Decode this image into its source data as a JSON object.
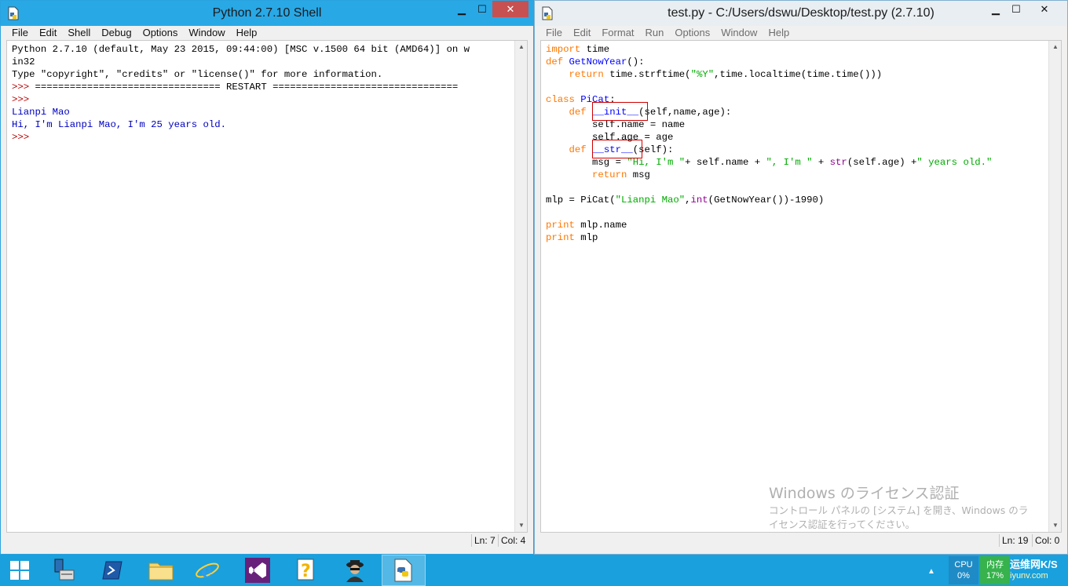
{
  "shell_window": {
    "title": "Python 2.7.10 Shell",
    "menu": [
      "File",
      "Edit",
      "Shell",
      "Debug",
      "Options",
      "Window",
      "Help"
    ],
    "lines": [
      "Python 2.7.10 (default, May 23 2015, 09:44:00) [MSC v.1500 64 bit (AMD64)] on w",
      "in32",
      "Type \"copyright\", \"credits\" or \"license()\" for more information.",
      ">>> ================================ RESTART ================================",
      ">>> ",
      "Lianpi Mao",
      "Hi, I'm Lianpi Mao, I'm 25 years old.",
      ">>> "
    ],
    "status_ln": "Ln: 7",
    "status_col": "Col: 4"
  },
  "editor_window": {
    "title": "test.py - C:/Users/dswu/Desktop/test.py (2.7.10)",
    "menu": [
      "File",
      "Edit",
      "Format",
      "Run",
      "Options",
      "Window",
      "Help"
    ],
    "code_lines": [
      "import time",
      "def GetNowYear():",
      "    return time.strftime(\"%Y\",time.localtime(time.time()))",
      "",
      "class PiCat:",
      "    def __init__(self,name,age):",
      "        self.name = name",
      "        self.age = age",
      "    def __str__(self):",
      "        msg = \"Hi, I'm \"+ self.name + \", I'm \" + str(self.age) +\" years old.\"",
      "        return msg",
      "",
      "mlp = PiCat(\"Lianpi Mao\",int(GetNowYear())-1990)",
      "",
      "print mlp.name",
      "print mlp"
    ],
    "status_ln": "Ln: 19",
    "status_col": "Col: 0",
    "watermark_title": "Windows のライセンス認証",
    "watermark_line1": "コントロール パネルの [システム] を開き、Windows のラ",
    "watermark_line2": "イセンス認証を行ってください。"
  },
  "taskbar": {
    "cpu_label": "CPU",
    "cpu_value": "0%",
    "mem_label": "内存",
    "mem_value": "17%",
    "site_text": "运维网",
    "site_sub": "iyunv.com",
    "net_text": "K/S",
    "tray_arrow": "▲"
  },
  "colors": {
    "keyword": "#ff7700",
    "definition": "#0000ff",
    "string": "#00aa00",
    "builtin": "#900090",
    "shell_output": "#0000c0",
    "highlight_box": "#d00000"
  }
}
